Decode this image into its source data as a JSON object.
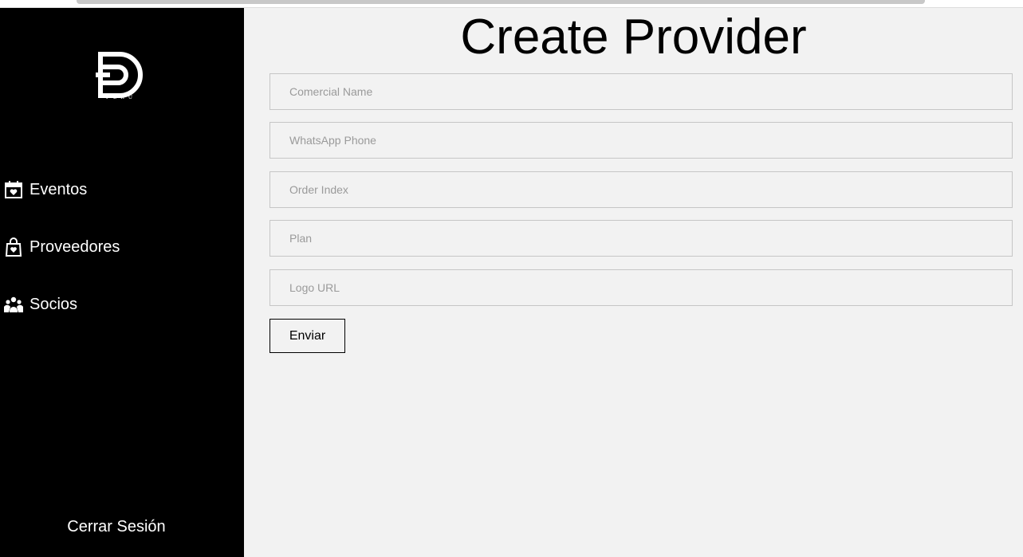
{
  "sidebar": {
    "logo_text": "PERÚ",
    "items": [
      {
        "label": "Eventos",
        "icon": "calendar-heart-icon"
      },
      {
        "label": "Proveedores",
        "icon": "shopping-bag-heart-icon"
      },
      {
        "label": "Socios",
        "icon": "users-group-icon"
      }
    ],
    "logout_label": "Cerrar Sesión"
  },
  "main": {
    "title": "Create Provider",
    "fields": [
      {
        "placeholder": "Comercial Name",
        "value": ""
      },
      {
        "placeholder": "WhatsApp Phone",
        "value": ""
      },
      {
        "placeholder": "Order Index",
        "value": ""
      },
      {
        "placeholder": "Plan",
        "value": ""
      },
      {
        "placeholder": "Logo URL",
        "value": ""
      }
    ],
    "submit_label": "Enviar"
  },
  "colors": {
    "sidebar_bg": "#000000",
    "main_bg": "#f2f2f2",
    "text": "#000000"
  }
}
